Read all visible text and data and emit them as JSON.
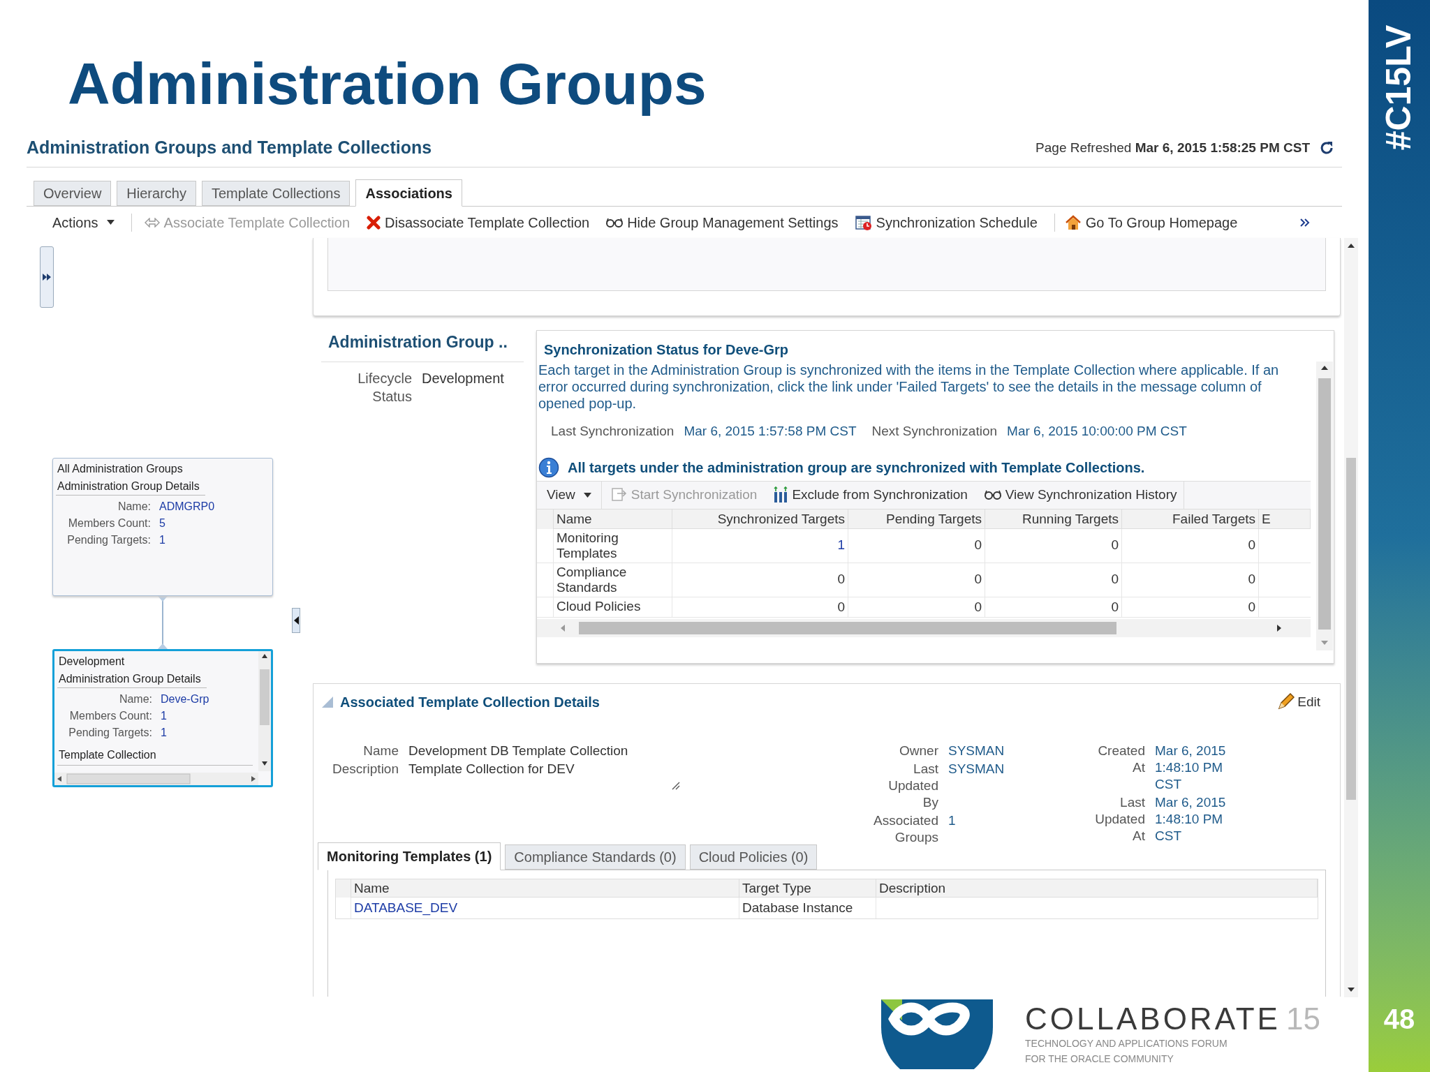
{
  "slide": {
    "title": "Administration Groups",
    "hashtag": "#C15LV",
    "page_number": "48",
    "footer": {
      "brand": "COLLABORATE",
      "edition": "15",
      "tagline": [
        "TECHNOLOGY AND APPLICATIONS FORUM",
        "FOR THE ORACLE COMMUNITY"
      ]
    }
  },
  "page": {
    "title": "Administration Groups and Template Collections",
    "refreshed_label": "Page Refreshed",
    "refreshed_value": "Mar 6, 2015 1:58:25 PM CST"
  },
  "tabs": [
    {
      "label": "Overview",
      "selected": false
    },
    {
      "label": "Hierarchy",
      "selected": false
    },
    {
      "label": "Template Collections",
      "selected": false
    },
    {
      "label": "Associations",
      "selected": true
    }
  ],
  "toolbar": [
    {
      "label": "Actions",
      "kind": "menu",
      "disabled": false
    },
    {
      "label": "Associate Template Collection",
      "kind": "action",
      "disabled": true
    },
    {
      "label": "Disassociate Template Collection",
      "kind": "action",
      "disabled": false
    },
    {
      "label": "Hide Group Management Settings",
      "kind": "action",
      "disabled": false
    },
    {
      "label": "Synchronization Schedule",
      "kind": "action",
      "disabled": false
    },
    {
      "label": "Go To Group Homepage",
      "kind": "action",
      "disabled": false
    }
  ],
  "hierarchy": {
    "nodes": [
      {
        "title": "All Administration Groups",
        "subtitle": "Administration Group Details",
        "selected": false,
        "fields": [
          {
            "label": "Name:",
            "value": "ADMGRP0"
          },
          {
            "label": "Members Count:",
            "value": "5"
          },
          {
            "label": "Pending Targets:",
            "value": "1"
          }
        ]
      },
      {
        "title": "Development",
        "subtitle": "Administration Group Details",
        "selected": true,
        "section": "Template Collection",
        "fields": [
          {
            "label": "Name:",
            "value": "Deve-Grp"
          },
          {
            "label": "Members Count:",
            "value": "1"
          },
          {
            "label": "Pending Targets:",
            "value": "1"
          }
        ]
      }
    ]
  },
  "group_summary": {
    "title": "Administration Group ..",
    "fields": [
      {
        "label": "Lifecycle Status",
        "value": "Development"
      }
    ]
  },
  "sync_status": {
    "title": "Synchronization Status for Deve-Grp",
    "description": "Each target in the Administration Group is synchronized with the items in the Template Collection where applicable. If an error occurred during synchronization, click the link under 'Failed Targets' to see the details in the message column of opened pop-up.",
    "last_label": "Last Synchronization",
    "last_value": "Mar 6, 2015 1:57:58 PM CST",
    "next_label": "Next Synchronization",
    "next_value": "Mar 6, 2015 10:00:00 PM CST",
    "message": "All targets under the administration group are synchronized with Template Collections.",
    "toolbar": [
      {
        "label": "View",
        "kind": "menu",
        "disabled": false
      },
      {
        "label": "Start Synchronization",
        "kind": "action",
        "disabled": true
      },
      {
        "label": "Exclude from Synchronization",
        "kind": "action",
        "disabled": false
      },
      {
        "label": "View Synchronization History",
        "kind": "action",
        "disabled": false
      }
    ],
    "columns": [
      "Name",
      "Synchronized Targets",
      "Pending Targets",
      "Running Targets",
      "Failed Targets",
      "E"
    ],
    "rows": [
      {
        "name": "Monitoring Templates",
        "synchronized_link": true,
        "values": [
          "1",
          "0",
          "0",
          "0"
        ]
      },
      {
        "name": "Compliance Standards",
        "synchronized_link": false,
        "values": [
          "0",
          "0",
          "0",
          "0"
        ]
      },
      {
        "name": "Cloud Policies",
        "synchronized_link": false,
        "values": [
          "0",
          "0",
          "0",
          "0"
        ]
      }
    ]
  },
  "details": {
    "title": "Associated Template Collection Details",
    "edit": "Edit",
    "left": [
      {
        "label": "Name",
        "value": "Development DB Template Collection"
      },
      {
        "label": "Description",
        "value": "Template Collection for DEV"
      }
    ],
    "middle": [
      {
        "label": "Owner",
        "value": "SYSMAN"
      },
      {
        "label": "Last Updated By",
        "value": "SYSMAN"
      },
      {
        "label": "Associated Groups",
        "value": "1"
      }
    ],
    "right": [
      {
        "label": "Created At",
        "value": "Mar 6, 2015 1:48:10 PM CST"
      },
      {
        "label": "Last Updated At",
        "value": "Mar 6, 2015 1:48:10 PM CST"
      }
    ],
    "tabs": [
      {
        "label": "Monitoring Templates (1)",
        "selected": true
      },
      {
        "label": "Compliance Standards (0)",
        "selected": false
      },
      {
        "label": "Cloud Policies (0)",
        "selected": false
      }
    ],
    "columns": [
      "Name",
      "Target Type",
      "Description"
    ],
    "rows": [
      {
        "name": "DATABASE_DEV",
        "target_type": "Database Instance"
      }
    ]
  }
}
